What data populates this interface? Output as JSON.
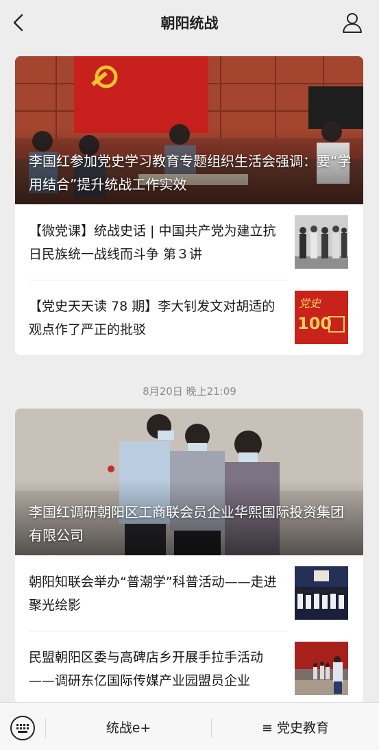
{
  "header": {
    "title": "朝阳统战",
    "back_icon": "chevron-left-icon",
    "profile_icon": "person-icon"
  },
  "card1": {
    "hero_title": "李国红参加党史学习教育专题组织生活会强调：要“学用结合”提升统战工作实效",
    "items": [
      {
        "text": "【微党课】统战史话 | 中国共产党为建立抗日民族统一战线而斗争 第３讲"
      },
      {
        "text": "【党史天天读 78 期】李大钊发文对胡适的观点作了严正的批驳",
        "thumb_text": "100"
      }
    ]
  },
  "timestamp": "8月20日 晚上21:09",
  "card2": {
    "hero_title": "李国红调研朝阳区工商联会员企业华熙国际投资集团有限公司",
    "items": [
      {
        "text": "朝阳知联会举办“普潮学”科普活动——走进聚光绘影"
      },
      {
        "text": "民盟朝阳区委与高碑店乡开展手拉手活动——调研东亿国际传媒产业园盟员企业"
      }
    ]
  },
  "bottom_bar": {
    "keyboard_icon": "keyboard-icon",
    "menu1": "统战e+",
    "menu2": "≡ 党史教育"
  }
}
